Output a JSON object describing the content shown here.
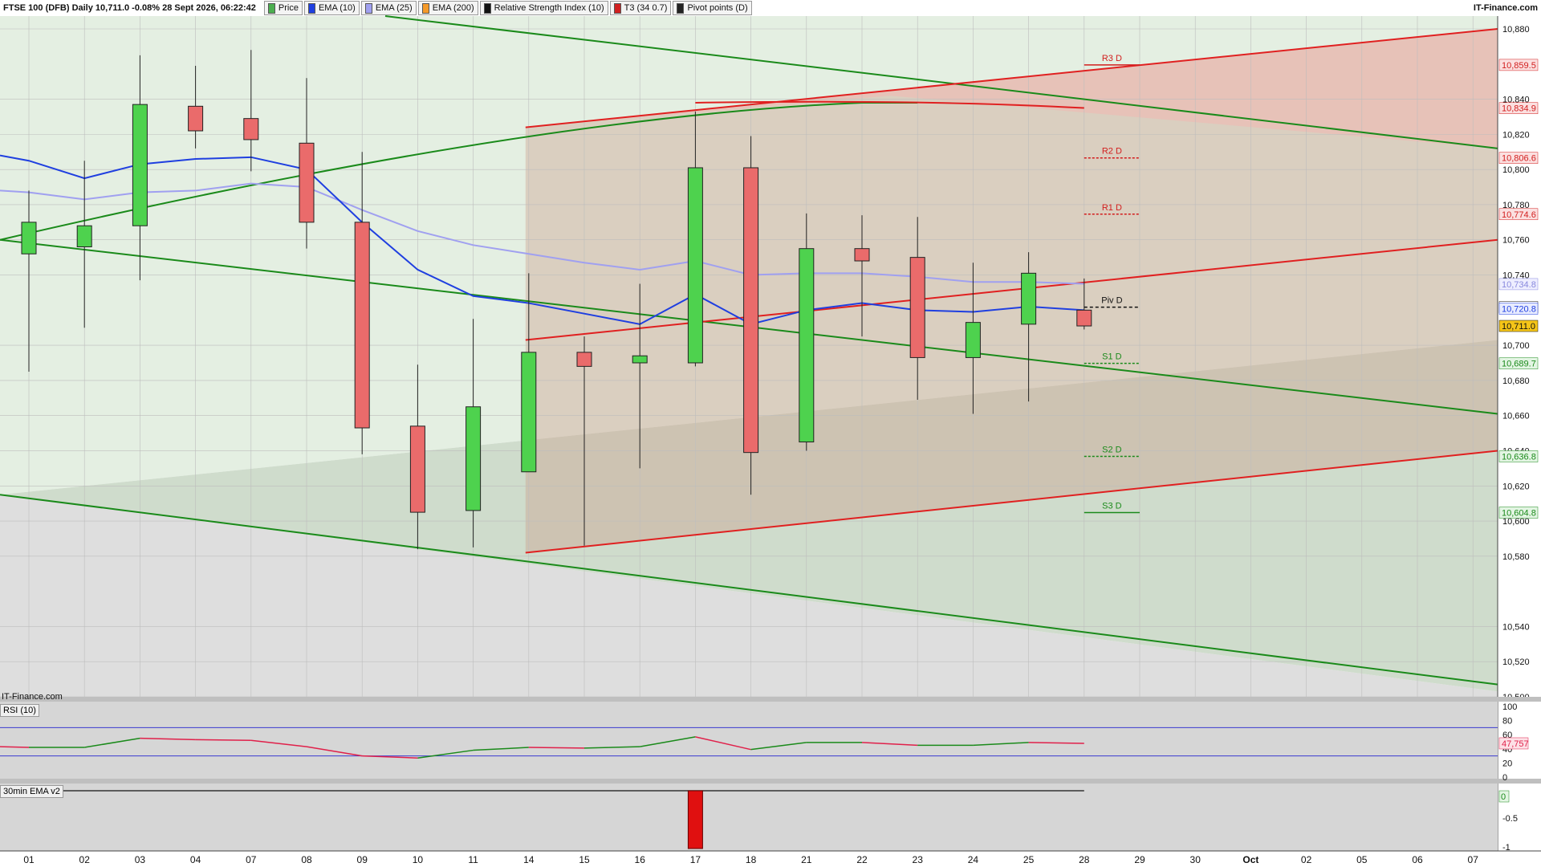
{
  "header": {
    "title": "FTSE 100 (DFB) Daily 10,711.0 -0.08% 28 Sept 2026, 06:22:42",
    "brand": "IT-Finance.com",
    "legend": [
      {
        "label": "Price",
        "color": "#4caf50"
      },
      {
        "label": "EMA (10)",
        "color": "#1f3fe0"
      },
      {
        "label": "EMA (25)",
        "color": "#a0a0f0"
      },
      {
        "label": "EMA (200)",
        "color": "#f59a2a"
      },
      {
        "label": "Relative Strength Index (10)",
        "color": "#111111"
      },
      {
        "label": "T3 (34 0.7)",
        "color": "#d02020"
      },
      {
        "label": "Pivot points (D)",
        "color": "#222222"
      }
    ]
  },
  "footer_brand": "IT-Finance.com",
  "rsi_label": "RSI (10)",
  "ema30_label": "30min EMA v2",
  "chart_data": {
    "type": "candlestick",
    "x_labels": [
      "01",
      "02",
      "03",
      "04",
      "07",
      "08",
      "09",
      "10",
      "11",
      "14",
      "15",
      "16",
      "17",
      "18",
      "21",
      "22",
      "23",
      "24",
      "25",
      "28",
      "29",
      "30",
      "Oct",
      "02",
      "05",
      "06",
      "07"
    ],
    "candles": [
      {
        "o": 10752,
        "h": 10788,
        "l": 10685,
        "c": 10770
      },
      {
        "o": 10756,
        "h": 10805,
        "l": 10710,
        "c": 10768
      },
      {
        "o": 10768,
        "h": 10865,
        "l": 10737,
        "c": 10837
      },
      {
        "o": 10836,
        "h": 10859,
        "l": 10812,
        "c": 10822
      },
      {
        "o": 10829,
        "h": 10868,
        "l": 10799,
        "c": 10817
      },
      {
        "o": 10815,
        "h": 10852,
        "l": 10755,
        "c": 10770
      },
      {
        "o": 10770,
        "h": 10810,
        "l": 10638,
        "c": 10653
      },
      {
        "o": 10654,
        "h": 10689,
        "l": 10584,
        "c": 10605
      },
      {
        "o": 10606,
        "h": 10715,
        "l": 10585,
        "c": 10665
      },
      {
        "o": 10628,
        "h": 10741,
        "l": 10628,
        "c": 10696
      },
      {
        "o": 10696,
        "h": 10705,
        "l": 10586,
        "c": 10688
      },
      {
        "o": 10690,
        "h": 10735,
        "l": 10630,
        "c": 10694
      },
      {
        "o": 10690,
        "h": 10833,
        "l": 10688,
        "c": 10801
      },
      {
        "o": 10801,
        "h": 10819,
        "l": 10615,
        "c": 10639
      },
      {
        "o": 10645,
        "h": 10775,
        "l": 10640,
        "c": 10755
      },
      {
        "o": 10755,
        "h": 10774,
        "l": 10705,
        "c": 10748
      },
      {
        "o": 10750,
        "h": 10773,
        "l": 10669,
        "c": 10693
      },
      {
        "o": 10693,
        "h": 10747,
        "l": 10661,
        "c": 10713
      },
      {
        "o": 10712,
        "h": 10753,
        "l": 10668,
        "c": 10741
      },
      {
        "o": 10720,
        "h": 10738,
        "l": 10709,
        "c": 10711
      }
    ],
    "ema10": [
      10805,
      10795,
      10803,
      10806,
      10807,
      10800,
      10770,
      10743,
      10728,
      10724,
      10718,
      10712,
      10729,
      10712,
      10720,
      10724,
      10720,
      10719,
      10722,
      10720
    ],
    "ema25": [
      10787,
      10783,
      10787,
      10788,
      10792,
      10790,
      10777,
      10765,
      10757,
      10752,
      10747,
      10743,
      10748,
      10740,
      10741,
      10741,
      10739,
      10736,
      10736,
      10735
    ],
    "pivots": [
      {
        "label": "R3 D",
        "value": 10859.5,
        "color": "#d21d1d"
      },
      {
        "label": "R2 D",
        "value": 10806.6,
        "color": "#d21d1d"
      },
      {
        "label": "R1 D",
        "value": 10774.6,
        "color": "#d21d1d"
      },
      {
        "label": "Piv D",
        "value": 10721.7,
        "color": "#111111"
      },
      {
        "label": "S1 D",
        "value": 10689.7,
        "color": "#1a8a1a"
      },
      {
        "label": "S2 D",
        "value": 10636.8,
        "color": "#1a8a1a"
      },
      {
        "label": "S3 D",
        "value": 10604.8,
        "color": "#1a8a1a"
      }
    ],
    "price_axis": {
      "ticks": [
        "10,880",
        "10,840",
        "10,820",
        "10,800",
        "10,780",
        "10,760",
        "10,740",
        "10,700",
        "10,680",
        "10,660",
        "10,640",
        "10,620",
        "10,600",
        "10,580",
        "10,540",
        "10,520",
        "10,500"
      ],
      "tick_values": [
        10880,
        10840,
        10820,
        10800,
        10780,
        10760,
        10740,
        10700,
        10680,
        10660,
        10640,
        10620,
        10600,
        10580,
        10540,
        10520,
        10500
      ],
      "ylim": [
        10500,
        10880
      ],
      "tags": [
        {
          "text": "10,859.5",
          "value": 10859.5,
          "bg": "#fbe0e0",
          "fg": "#d21d1d"
        },
        {
          "text": "10,834.9",
          "value": 10834.9,
          "bg": "#fbe0e0",
          "fg": "#d21d1d"
        },
        {
          "text": "10,806.6",
          "value": 10806.6,
          "bg": "#fbe0e0",
          "fg": "#d21d1d"
        },
        {
          "text": "10,774.6",
          "value": 10774.6,
          "bg": "#fbe0e0",
          "fg": "#d21d1d"
        },
        {
          "text": "10,734.8",
          "value": 10734.8,
          "bg": "#eeeeff",
          "fg": "#8888dd"
        },
        {
          "text": "10,721.7",
          "value": 10721.7,
          "bg": "#ffffff",
          "fg": "#111111"
        },
        {
          "text": "10,720.8",
          "value": 10720.8,
          "bg": "#e8ecff",
          "fg": "#1f3fe0"
        },
        {
          "text": "10,711.0",
          "value": 10711.0,
          "bg": "#f5c518",
          "fg": "#111111"
        },
        {
          "text": "10,689.7",
          "value": 10689.7,
          "bg": "#e3f5e3",
          "fg": "#1a8a1a"
        },
        {
          "text": "10,636.8",
          "value": 10636.8,
          "bg": "#e3f5e3",
          "fg": "#1a8a1a"
        },
        {
          "text": "10,604.8",
          "value": 10604.8,
          "bg": "#e3f5e3",
          "fg": "#1a8a1a"
        }
      ]
    },
    "rsi": {
      "values": [
        42,
        42,
        55,
        53,
        52,
        43,
        30,
        27,
        38,
        42,
        41,
        43,
        57,
        39,
        49,
        49,
        45,
        45,
        49,
        47.757
      ],
      "levels": [
        70,
        30
      ],
      "ticks": [
        "100",
        "80",
        "60",
        "40",
        "20",
        "0"
      ],
      "tick_values": [
        100,
        80,
        60,
        40,
        20,
        0
      ],
      "last": "47,757"
    },
    "ema30": {
      "ticks": [
        "0",
        "-0.5",
        "-1"
      ],
      "last": "0",
      "bar_index": 12
    }
  }
}
